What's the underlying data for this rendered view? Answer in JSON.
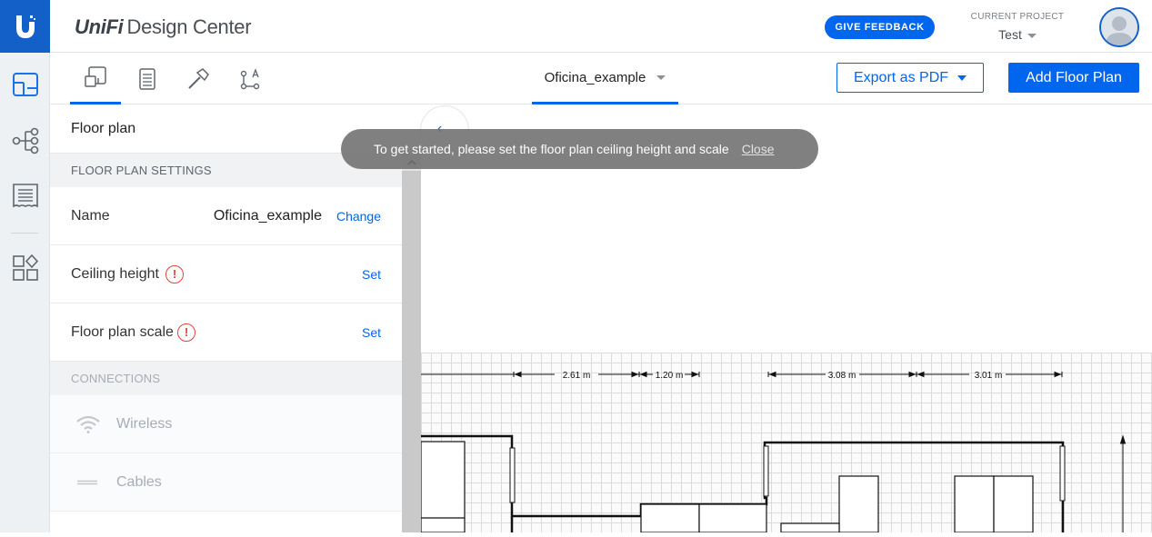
{
  "header": {
    "brand_prefix": "UniFi",
    "brand_suffix": "Design Center",
    "feedback_label": "GIVE FEEDBACK",
    "project_caption": "CURRENT PROJECT",
    "project_name": "Test"
  },
  "toolbar": {
    "floor_plan_name": "Oficina_example",
    "export_label": "Export as PDF",
    "add_label": "Add Floor Plan"
  },
  "rail": {
    "items": [
      "floor-plan-icon",
      "topology-icon",
      "bill-of-materials-icon",
      "devices-icon"
    ]
  },
  "panel": {
    "title": "Floor plan",
    "settings_header": "FLOOR PLAN SETTINGS",
    "name_label": "Name",
    "name_value": "Oficina_example",
    "name_action": "Change",
    "ceiling_label": "Ceiling height",
    "ceiling_action": "Set",
    "scale_label": "Floor plan scale",
    "scale_action": "Set",
    "warning_glyph": "!",
    "connections_header": "CONNECTIONS",
    "wireless_label": "Wireless",
    "cables_label": "Cables"
  },
  "toast": {
    "message": "To get started, please set the floor plan ceiling height and scale",
    "close_label": "Close"
  },
  "plan": {
    "dimensions": [
      "2.61 m",
      "1.20 m",
      "3.08 m",
      "3.01 m"
    ]
  },
  "colors": {
    "accent": "#0066ee",
    "brand": "#1360c9",
    "warning": "#e0443a"
  }
}
